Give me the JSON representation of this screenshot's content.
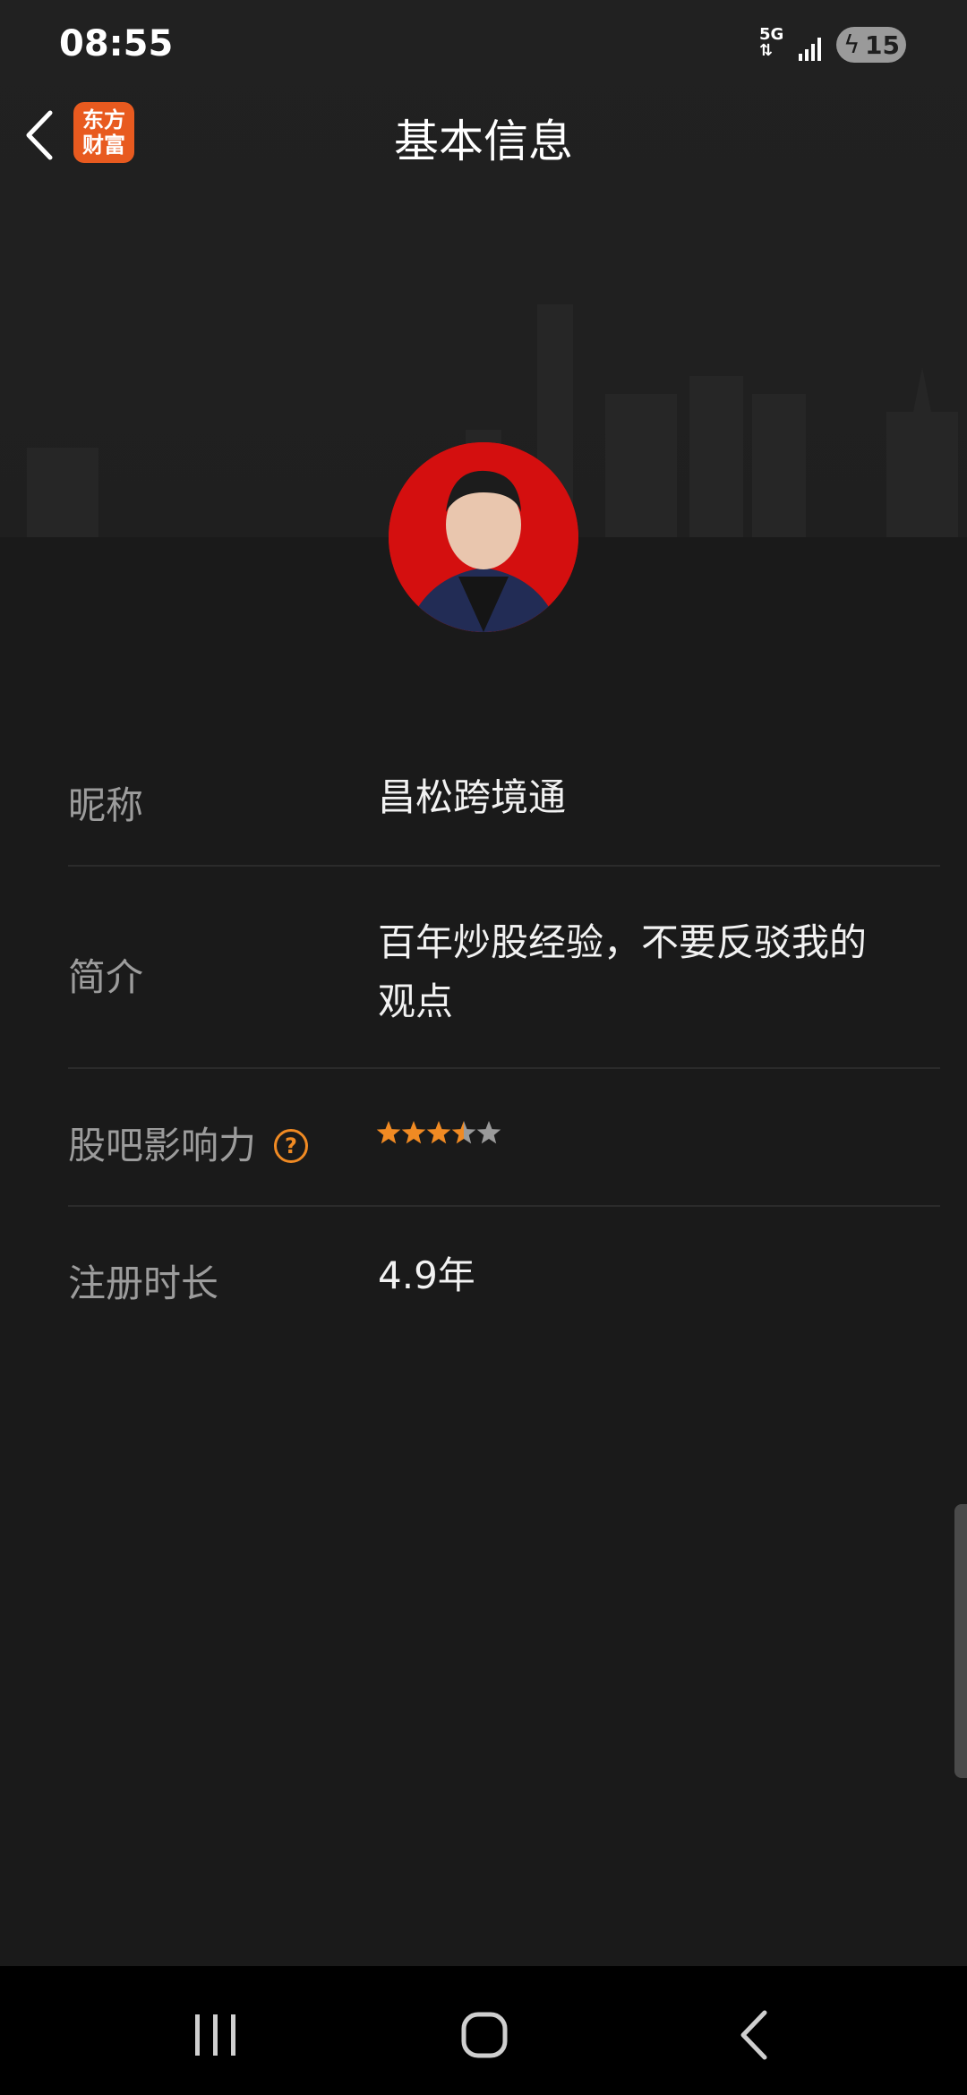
{
  "status_bar": {
    "time": "08:55",
    "network": "5G",
    "battery": "15"
  },
  "header": {
    "title": "基本信息",
    "app_logo_text": "东方财富"
  },
  "profile": {
    "fields": [
      {
        "label": "昵称",
        "value": "昌松跨境通"
      },
      {
        "label": "简介",
        "value_line1": "百年炒股经验，不要反驳我的",
        "value_line2": "观点"
      },
      {
        "label": "股吧影响力",
        "rating": 3.5,
        "max_rating": 5
      },
      {
        "label": "注册时长",
        "value": "4.9年"
      }
    ]
  },
  "colors": {
    "accent": "#f08a23",
    "brand": "#e85a1f",
    "background": "#1a1a1a"
  }
}
